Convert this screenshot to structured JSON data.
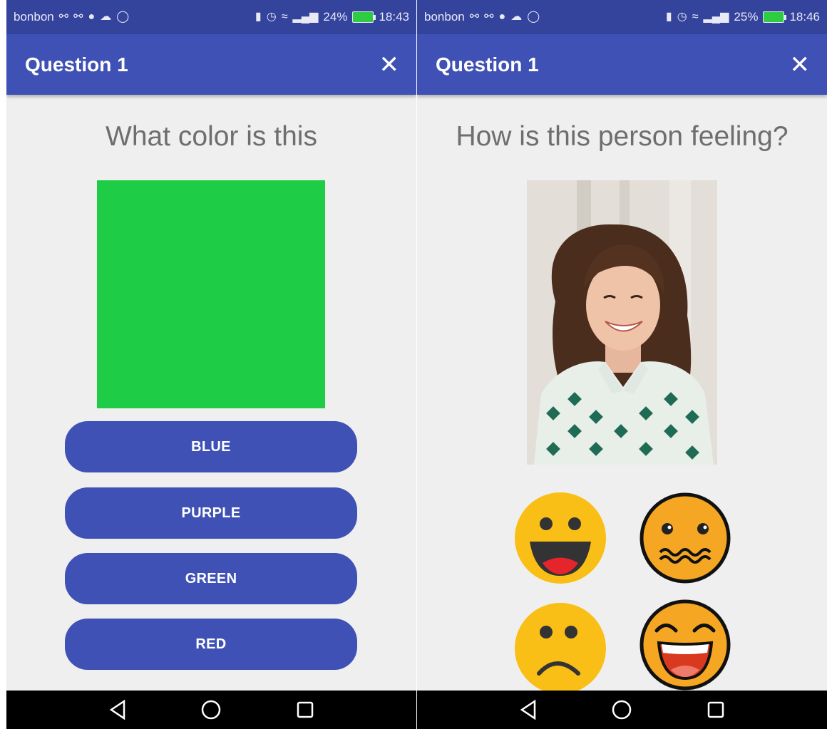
{
  "left_screen": {
    "status": {
      "carrier": "bonbon",
      "battery_percent": "24%",
      "time": "18:43",
      "battery_level": 0.24
    },
    "toolbar": {
      "title": "Question 1",
      "close_icon": "close-icon"
    },
    "question": "What color is this",
    "swatch_color": "#1ecd45",
    "answers": [
      "BLUE",
      "PURPLE",
      "GREEN",
      "RED"
    ],
    "nav": [
      "back-icon",
      "home-icon",
      "recents-icon"
    ]
  },
  "right_screen": {
    "status": {
      "carrier": "bonbon",
      "battery_percent": "25%",
      "time": "18:46",
      "battery_level": 0.25
    },
    "toolbar": {
      "title": "Question 1",
      "close_icon": "close-icon"
    },
    "question": "How is this person feeling?",
    "photo": "smiling-woman-photo",
    "emoji_options": [
      "happy-face-icon",
      "nervous-face-icon",
      "sad-face-icon",
      "laughing-face-icon"
    ],
    "nav": [
      "back-icon",
      "home-icon",
      "recents-icon"
    ]
  },
  "colors": {
    "primary": "#3f51b5",
    "primary_dark": "#34439c",
    "background": "#efefef",
    "question_text": "#6e6e6e",
    "emoji_yellow": "#f9bf16",
    "emoji_orange": "#f5a623"
  }
}
